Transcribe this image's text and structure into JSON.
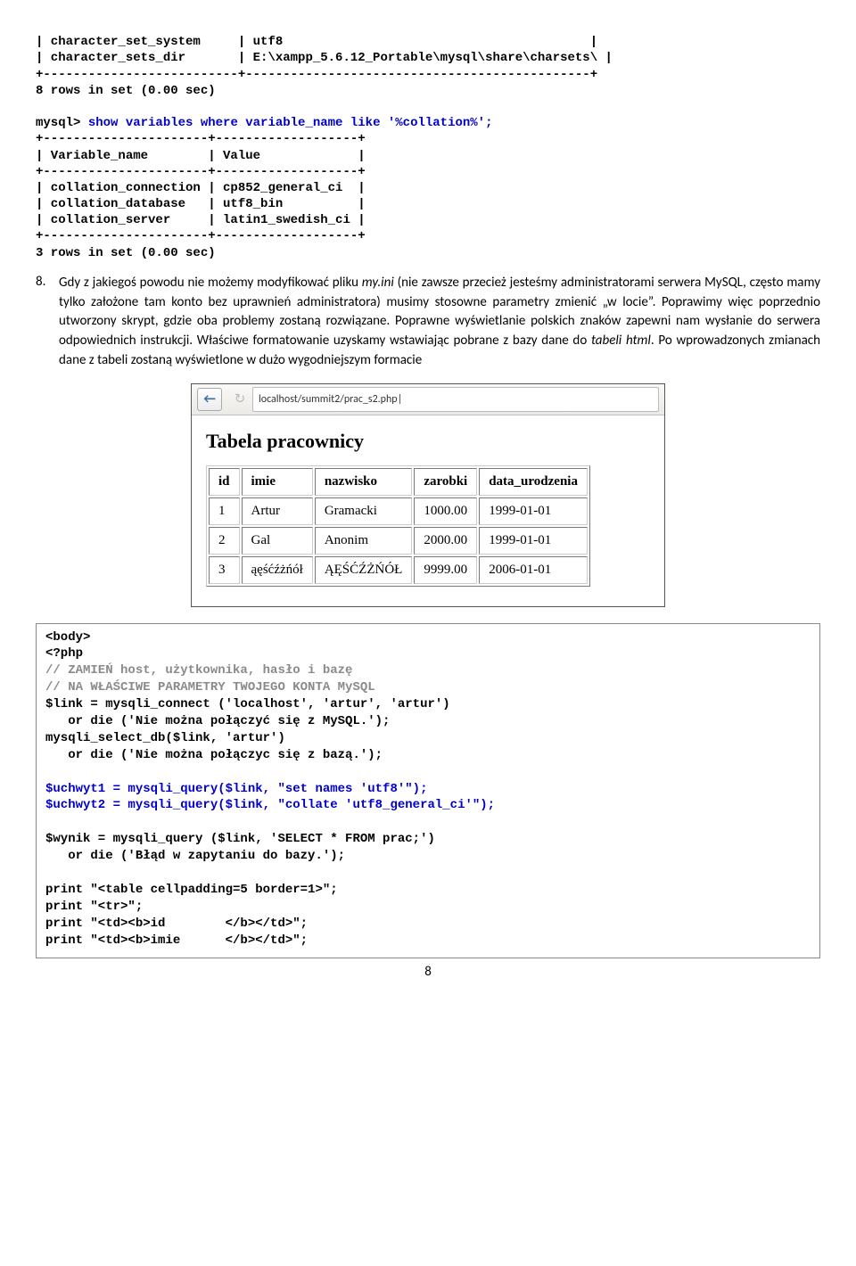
{
  "sql_top": {
    "l1": "| character_set_system     | utf8                                         |",
    "l2": "| character_sets_dir       | E:\\xampp_5.6.12_Portable\\mysql\\share\\charsets\\ |",
    "l3": "+--------------------------+----------------------------------------------+",
    "l4": "8 rows in set (0.00 sec)",
    "l5": "",
    "l6a": "mysql> ",
    "l6b": "show variables where variable_name like '%collation%';",
    "l7": "+----------------------+-------------------+",
    "l8": "| Variable_name        | Value             |",
    "l9": "+----------------------+-------------------+",
    "l10": "| collation_connection | cp852_general_ci  |",
    "l11": "| collation_database   | utf8_bin          |",
    "l12": "| collation_server     | latin1_swedish_ci |",
    "l13": "+----------------------+-------------------+",
    "l14": "3 rows in set (0.00 sec)"
  },
  "paragraph": {
    "num": "8.",
    "text": "Gdy z jakiegoś powodu nie możemy modyfikować pliku <i>my.ini</i> (nie zawsze przecież jesteśmy administratorami serwera MySQL, często mamy tylko założone tam konto bez uprawnień administratora) musimy stosowne parametry zmienić „w locie”. Poprawimy więc poprzednio utworzony skrypt, gdzie oba problemy zostaną rozwiązane. Poprawne wyświetlanie polskich znaków zapewni nam wysłanie do serwera odpowiednich instrukcji. Właściwe formatowanie uzyskamy wstawiając pobrane z bazy dane do <i>tabeli html</i>. Po wprowadzonych zmianach dane z tabeli zostaną wyświetlone w dużo wygodniejszym formacie"
  },
  "browser": {
    "url": "localhost/summit2/prac_s2.php|",
    "heading": "Tabela pracownicy",
    "headers": [
      "id",
      "imie",
      "nazwisko",
      "zarobki",
      "data_urodzenia"
    ],
    "rows": [
      [
        "1",
        "Artur",
        "Gramacki",
        "1000.00",
        "1999-01-01"
      ],
      [
        "2",
        "Gal",
        "Anonim",
        "2000.00",
        "1999-01-01"
      ],
      [
        "3",
        "ąęśćźżńół",
        "ĄĘŚĆŹŻŃÓŁ",
        "9999.00",
        "2006-01-01"
      ]
    ]
  },
  "code": {
    "l1": "<body>",
    "l2": "<?php",
    "c1": "// ZAMIEŃ host, użytkownika, hasło i bazę",
    "c2": "// NA WŁAŚCIWE PARAMETRY TWOJEGO KONTA MySQL",
    "l3": "$link = mysqli_connect ('localhost', 'artur', 'artur')",
    "l4": "   or die ('Nie można połączyć się z MySQL.');",
    "l5": "mysqli_select_db($link, 'artur')",
    "l6": "   or die ('Nie można połączyc się z bazą.');",
    "l7": "",
    "b1": "$uchwyt1 = mysqli_query($link, \"set names 'utf8'\");",
    "b2": "$uchwyt2 = mysqli_query($link, \"collate 'utf8_general_ci'\");",
    "l8": "",
    "l9": "$wynik = mysqli_query ($link, 'SELECT * FROM prac;')",
    "l10": "   or die ('Błąd w zapytaniu do bazy.');",
    "l11": "",
    "l12": "print \"<table cellpadding=5 border=1>\";",
    "l13": "print \"<tr>\";",
    "l14": "print \"<td><b>id        </b></td>\";",
    "l15": "print \"<td><b>imie      </b></td>\";"
  },
  "pagenum": "8"
}
